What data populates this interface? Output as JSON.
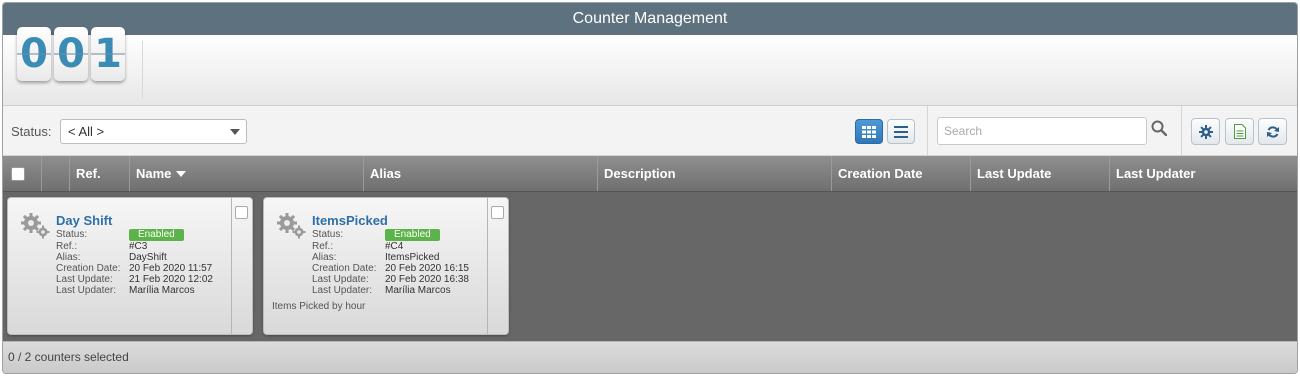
{
  "window": {
    "title": "Counter Management"
  },
  "counter": {
    "digits": [
      "0",
      "0",
      "1"
    ]
  },
  "toolbar": {
    "status_label": "Status:",
    "status_value": "< All >",
    "search_placeholder": "Search"
  },
  "grid": {
    "columns": [
      "Ref.",
      "Name",
      "Alias",
      "Description",
      "Creation Date",
      "Last Update",
      "Last Updater"
    ],
    "sorted_column": "Name"
  },
  "prop_labels": {
    "status": "Status:",
    "ref": "Ref.:",
    "alias": "Alias:",
    "creation_date": "Creation Date:",
    "last_update": "Last Update:",
    "last_updater": "Last Updater:"
  },
  "cards": [
    {
      "name": "Day Shift",
      "status": "Enabled",
      "ref": "#C3",
      "alias": "DayShift",
      "creation_date": "20 Feb 2020 11:57",
      "last_update": "21 Feb 2020 12:02",
      "last_updater": "Marília Marcos",
      "description": ""
    },
    {
      "name": "ItemsPicked",
      "status": "Enabled",
      "ref": "#C4",
      "alias": "ItemsPicked",
      "creation_date": "20 Feb 2020 16:15",
      "last_update": "20 Feb 2020 16:38",
      "last_updater": "Marília Marcos",
      "description": "Items Picked by hour"
    }
  ],
  "footer": {
    "selection_text": "0 / 2 counters selected"
  },
  "colors": {
    "titlebar": "#5e717e",
    "accent": "#2f78b8",
    "enabled": "#5bb34a",
    "name_link": "#2f6fa8"
  }
}
